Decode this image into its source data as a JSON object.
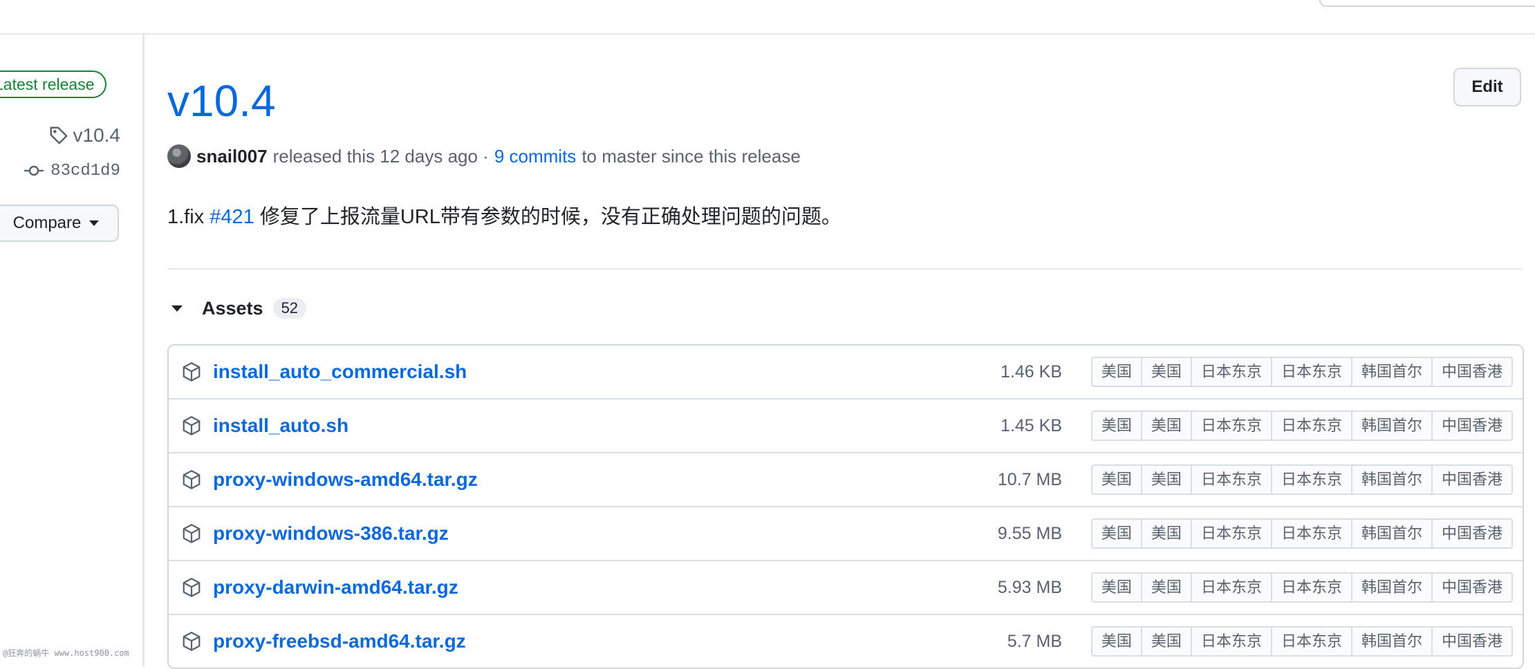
{
  "release": {
    "badge": "Latest release",
    "tag": "v10.4",
    "commit": "83cd1d9",
    "compare_label": "Compare",
    "title": "v10.4",
    "edit_label": "Edit",
    "author": "snail007",
    "released_text": "released this 12 days ago ·",
    "commits_link": "9 commits",
    "since_text": "to master since this release",
    "notes_prefix": "1.fix",
    "notes_issue": "#421",
    "notes_text": "修复了上报流量URL带有参数的时候，没有正确处理问题的问题。"
  },
  "assets": {
    "title": "Assets",
    "count": "52",
    "items": [
      {
        "name": "install_auto_commercial.sh",
        "size": "1.46 KB",
        "mirrors": [
          "美国",
          "美国",
          "日本东京",
          "日本东京",
          "韩国首尔",
          "中国香港"
        ]
      },
      {
        "name": "install_auto.sh",
        "size": "1.45 KB",
        "mirrors": [
          "美国",
          "美国",
          "日本东京",
          "日本东京",
          "韩国首尔",
          "中国香港"
        ]
      },
      {
        "name": "proxy-windows-amd64.tar.gz",
        "size": "10.7 MB",
        "mirrors": [
          "美国",
          "美国",
          "日本东京",
          "日本东京",
          "韩国首尔",
          "中国香港"
        ]
      },
      {
        "name": "proxy-windows-386.tar.gz",
        "size": "9.55 MB",
        "mirrors": [
          "美国",
          "美国",
          "日本东京",
          "日本东京",
          "韩国首尔",
          "中国香港"
        ]
      },
      {
        "name": "proxy-darwin-amd64.tar.gz",
        "size": "5.93 MB",
        "mirrors": [
          "美国",
          "美国",
          "日本东京",
          "日本东京",
          "韩国首尔",
          "中国香港"
        ]
      },
      {
        "name": "proxy-freebsd-amd64.tar.gz",
        "size": "5.7 MB",
        "mirrors": [
          "美国",
          "美国",
          "日本东京",
          "日本东京",
          "韩国首尔",
          "中国香港"
        ]
      }
    ]
  },
  "watermark": "@狂奔的蜗牛 www.host900.com",
  "colors": {
    "link": "#0969da",
    "latest_green": "#1a7f37",
    "border": "#d0d7de",
    "muted_text": "#59636e"
  }
}
